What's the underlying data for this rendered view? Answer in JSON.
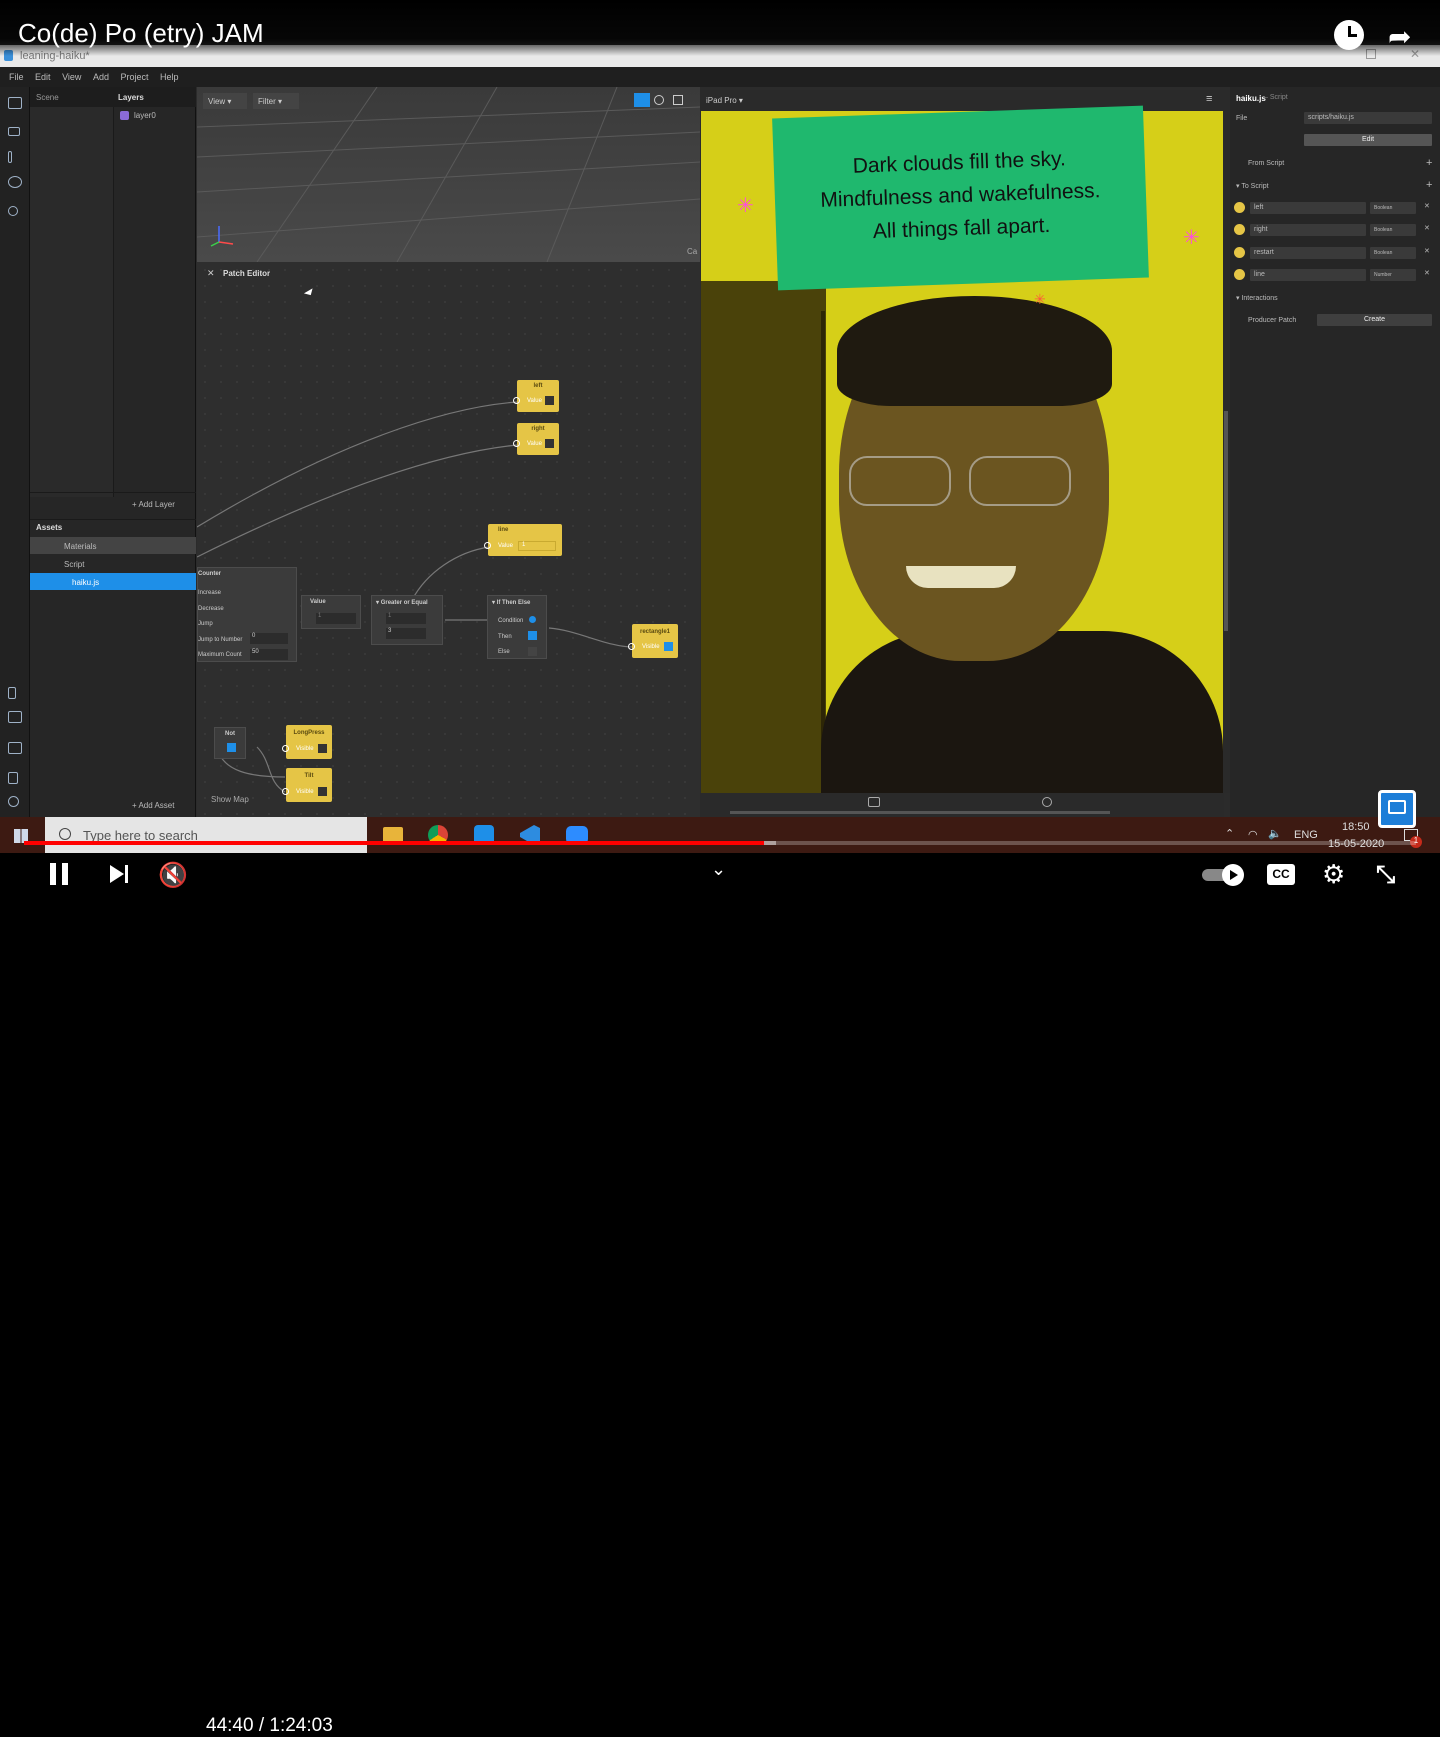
{
  "video": {
    "title": "Co(de) Po (etry) JAM",
    "time_current": "44:40",
    "time_separator": "/",
    "time_total": "1:24:03",
    "progress": 0.5316,
    "buffered": 0.54,
    "accent": "#ff0000"
  },
  "app": {
    "window_title": "leaning-haiku*",
    "menu": [
      "File",
      "Edit",
      "View",
      "Add",
      "Project",
      "Help"
    ],
    "scene_tabs": {
      "scene": "Scene",
      "layers": "Layers"
    },
    "layer_item": "layer0",
    "add_layer": "Add Layer",
    "assets_heading": "Assets",
    "assets": {
      "materials": "Materials",
      "script": "Script",
      "file": "haiku.js"
    },
    "add_asset": "Add Asset",
    "viewport_controls": {
      "view": "View",
      "filter": "Filter",
      "device": "iPad Pro",
      "cam_label": "Ca"
    },
    "patch_editor_title": "Patch Editor",
    "show_map": "Show Map",
    "nodes": {
      "left": {
        "title": "left",
        "port": "Value"
      },
      "right": {
        "title": "right",
        "port": "Value"
      },
      "line": {
        "title": "line",
        "port": "Value",
        "value": "1"
      },
      "counter": {
        "title": "Counter",
        "rows": [
          "Increase",
          "Decrease",
          "Jump",
          "Jump to Number",
          "Maximum Count"
        ],
        "jump_to": "0",
        "max_count": "50"
      },
      "value": {
        "title": "Value",
        "v": "1"
      },
      "gte": {
        "title": "Greater or Equal",
        "a": "1",
        "b": "3"
      },
      "ifthen": {
        "title": "If Then Else",
        "rows": [
          "Condition",
          "Then",
          "Else"
        ]
      },
      "rectangle": {
        "title": "rectangle1",
        "port": "Visible"
      },
      "not": {
        "title": "Not"
      },
      "longpress": {
        "title": "LongPress",
        "port": "Visible"
      },
      "tilt": {
        "title": "Tilt",
        "port": "Visible"
      }
    },
    "camera_text": [
      "Dark clouds fill the sky.",
      "Mindfulness and wakefulness.",
      "All things fall apart."
    ],
    "right_panel": {
      "file_title": "haiku.js",
      "file_sub": "– Script",
      "file_label": "File",
      "file_value": "scripts/haiku.js",
      "edit_button": "Edit",
      "from_script": "From Script",
      "to_script": "To Script",
      "vars": [
        {
          "name": "left",
          "type": "Boolean"
        },
        {
          "name": "right",
          "type": "Boolean"
        },
        {
          "name": "restart",
          "type": "Boolean"
        },
        {
          "name": "line",
          "type": "Number"
        }
      ],
      "interactions": "Interactions",
      "producer_patch": "Producer Patch",
      "create_button": "Create"
    }
  },
  "taskbar": {
    "search_placeholder": "Type here to search",
    "lang": "ENG",
    "clock_time": "18:50",
    "clock_date": "15-05-2020",
    "notif_count": "1"
  }
}
